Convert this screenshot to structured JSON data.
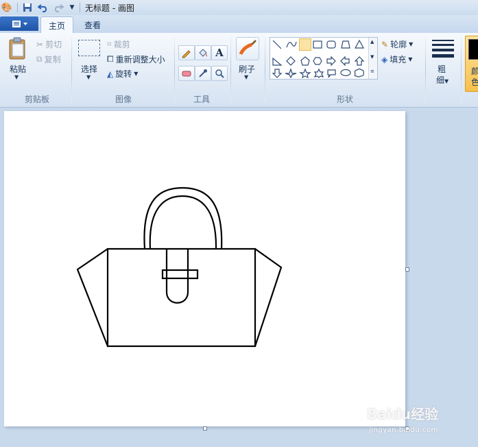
{
  "window": {
    "title": "无标题 - 画图"
  },
  "tabs": {
    "file_icon": "file-menu-icon",
    "home": "主页",
    "view": "查看"
  },
  "clipboard": {
    "paste": "粘贴",
    "cut": "剪切",
    "copy": "复制",
    "label": "剪贴板"
  },
  "image": {
    "select": "选择",
    "crop": "裁剪",
    "resize": "重新调整大小",
    "rotate": "旋转",
    "label": "图像"
  },
  "tools": {
    "label": "工具"
  },
  "brushes": {
    "label": "刷子"
  },
  "shapes": {
    "outline": "轮廓",
    "fill": "填充",
    "label": "形状"
  },
  "size": {
    "label_line1": "粗",
    "label_line2": "细"
  },
  "colors": {
    "label_line1": "颜",
    "label_line2": "色",
    "color1": "#000000"
  },
  "watermark": {
    "brand": "Baidu经验",
    "url": "jingyan.baidu.com"
  }
}
